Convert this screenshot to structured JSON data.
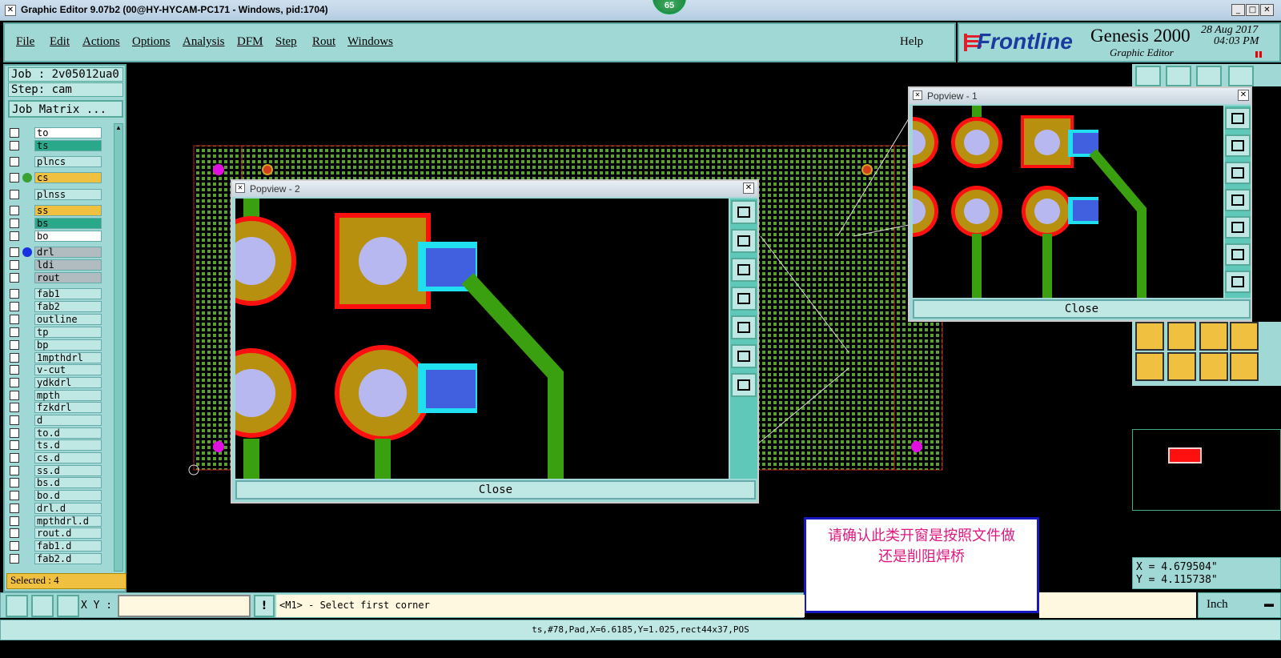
{
  "window": {
    "title": "Graphic Editor 9.07b2 (00@HY-HYCAM-PC171 - Windows, pid:1704)",
    "badge": "65"
  },
  "menu": {
    "items": [
      "File",
      "Edit",
      "Actions",
      "Options",
      "Analysis",
      "DFM",
      "Step",
      "Rout",
      "Windows"
    ],
    "help": "Help"
  },
  "brand": {
    "logo": "Frontline",
    "product": "Genesis 2000",
    "subtitle": "Graphic Editor",
    "date": "28 Aug 2017",
    "time": "04:03 PM"
  },
  "job": {
    "job_label": "Job : 2v05012ua0",
    "step_label": "Step: cam",
    "matrix_button": "Job Matrix ..."
  },
  "layers": [
    {
      "name": "to",
      "bg": "#ffffff"
    },
    {
      "name": "ts",
      "bg": "#2aa88a"
    },
    {
      "name": "plncs",
      "bg": "#bfe8e4"
    },
    {
      "name": "cs",
      "bg": "#f0c040"
    },
    {
      "name": "plnss",
      "bg": "#bfe8e4"
    },
    {
      "name": "ss",
      "bg": "#f0c040"
    },
    {
      "name": "bs",
      "bg": "#2aa88a"
    },
    {
      "name": "bo",
      "bg": "#ffffff"
    },
    {
      "name": "drl",
      "bg": "#b0bcc0"
    },
    {
      "name": "ldi",
      "bg": "#b0bcc0"
    },
    {
      "name": "rout",
      "bg": "#b0bcc0"
    },
    {
      "name": "fab1",
      "bg": "#bfe8e4"
    },
    {
      "name": "fab2",
      "bg": "#bfe8e4"
    },
    {
      "name": "outline",
      "bg": "#bfe8e4"
    },
    {
      "name": "tp",
      "bg": "#bfe8e4"
    },
    {
      "name": "bp",
      "bg": "#bfe8e4"
    },
    {
      "name": "1mpthdrl",
      "bg": "#bfe8e4"
    },
    {
      "name": "v-cut",
      "bg": "#bfe8e4"
    },
    {
      "name": "ydkdrl",
      "bg": "#bfe8e4"
    },
    {
      "name": "mpth",
      "bg": "#bfe8e4"
    },
    {
      "name": "fzkdrl",
      "bg": "#bfe8e4"
    },
    {
      "name": "d",
      "bg": "#bfe8e4"
    },
    {
      "name": "to.d",
      "bg": "#bfe8e4"
    },
    {
      "name": "ts.d",
      "bg": "#bfe8e4"
    },
    {
      "name": "cs.d",
      "bg": "#bfe8e4"
    },
    {
      "name": "ss.d",
      "bg": "#bfe8e4"
    },
    {
      "name": "bs.d",
      "bg": "#bfe8e4"
    },
    {
      "name": "bo.d",
      "bg": "#bfe8e4"
    },
    {
      "name": "drl.d",
      "bg": "#bfe8e4"
    },
    {
      "name": "mpthdrl.d",
      "bg": "#bfe8e4"
    },
    {
      "name": "rout.d",
      "bg": "#bfe8e4"
    },
    {
      "name": "fab1.d",
      "bg": "#bfe8e4"
    },
    {
      "name": "fab2.d",
      "bg": "#bfe8e4"
    }
  ],
  "selected": "Selected : 4",
  "popview2": {
    "title": "Popview - 2",
    "close": "Close"
  },
  "popview1": {
    "title": "Popview - 1",
    "close": "Close"
  },
  "note": {
    "line1": "请确认此类开窗是按照文件做",
    "line2": "还是削阻焊桥"
  },
  "coords": {
    "x": "X = 4.679504\"",
    "y": "Y = 4.115738\""
  },
  "bottom": {
    "xy_label": "X Y :",
    "prompt": "<M1> - Select first corner",
    "units": "Inch",
    "status": "ts,#78,Pad,X=6.6185,Y=1.025,rect44x37,POS"
  }
}
